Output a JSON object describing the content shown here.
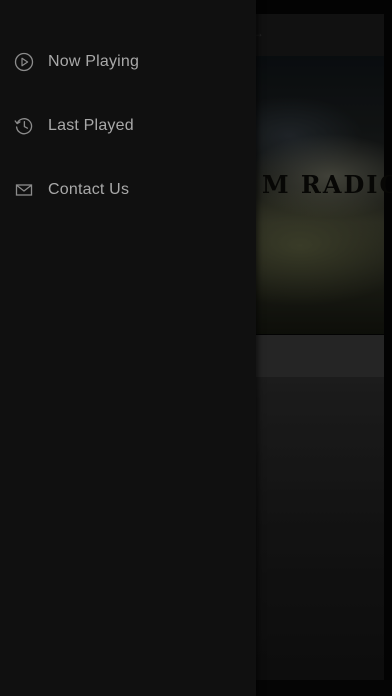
{
  "drawer": {
    "items": [
      {
        "label": "Now Playing",
        "icon": "play-circle-icon"
      },
      {
        "label": "Last Played",
        "icon": "history-icon"
      },
      {
        "label": "Contact Us",
        "icon": "mail-icon"
      }
    ]
  },
  "background": {
    "artwork_text": "M RADIO",
    "indicator": "→"
  },
  "colors": {
    "drawer_bg": "#101010",
    "menu_text": "#a9a9a9",
    "icon_stroke": "#8c8c8c"
  }
}
